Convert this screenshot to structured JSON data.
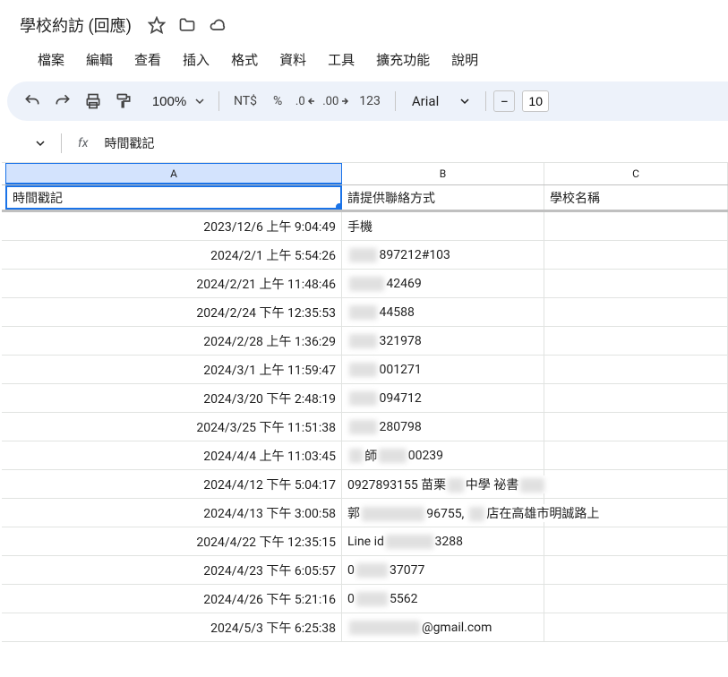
{
  "doc": {
    "title": "學校約訪 (回應)"
  },
  "menu": {
    "file": "檔案",
    "edit": "編輯",
    "view": "查看",
    "insert": "插入",
    "format": "格式",
    "data": "資料",
    "tools": "工具",
    "extensions": "擴充功能",
    "help": "說明"
  },
  "toolbar": {
    "zoom": "100%",
    "currency": "NT$",
    "percent": "%",
    "dec_dec": ".0",
    "inc_dec": ".00",
    "more_fmt": "123",
    "font": "Arial",
    "font_size": "10"
  },
  "formula": {
    "fx": "fx",
    "text": "時間戳記"
  },
  "columns": {
    "A": "A",
    "B": "B",
    "C": "C"
  },
  "headers": {
    "A": "時間戳記",
    "B": "請提供聯絡方式",
    "C": "學校名稱"
  },
  "rows": [
    {
      "A": "2023/12/6 上午 9:04:49",
      "B": "手機",
      "C": ""
    },
    {
      "A": "2024/2/1 上午 5:54:26",
      "B_pre": "",
      "B_mask": "0000",
      "B_post": "897212#103",
      "C": ""
    },
    {
      "A": "2024/2/21 上午 11:48:46",
      "B_pre": "",
      "B_mask": "00000",
      "B_post": "42469",
      "C": ""
    },
    {
      "A": "2024/2/24 下午 12:35:53",
      "B_pre": "",
      "B_mask": "0000",
      "B_post": "44588",
      "C": ""
    },
    {
      "A": "2024/2/28 上午 1:36:29",
      "B_pre": "",
      "B_mask": "0000",
      "B_post": "321978",
      "C": ""
    },
    {
      "A": "2024/3/1 上午 11:59:47",
      "B_pre": "",
      "B_mask": "0000",
      "B_post": "001271",
      "C": ""
    },
    {
      "A": "2024/3/20 下午 2:48:19",
      "B_pre": "",
      "B_mask": "0000",
      "B_post": "094712",
      "C": ""
    },
    {
      "A": "2024/3/25 下午 11:51:38",
      "B_pre": "",
      "B_mask": "0000",
      "B_post": "280798",
      "C": ""
    },
    {
      "A": "2024/4/4 上午 11:03:45",
      "B_pre": "",
      "B_mask": "aa",
      "B_mid": "師",
      "B_mask2": "aaaa",
      "B_post": "00239",
      "C": ""
    },
    {
      "A": "2024/4/12 下午 5:04:17",
      "B_overflow": true,
      "B_pre": "0927893155 苗栗",
      "B_mask": "XX",
      "B_mid": "中學 祕書",
      "B_mask2": "XXX",
      "B_post": "",
      "C": ""
    },
    {
      "A": "2024/4/13 下午 3:00:58",
      "B_overflow": true,
      "B_pre": "郭",
      "B_mask": "XXXXXXXX",
      "B_mid": "96755, ",
      "B_mask2": "XX",
      "B_post": "店在高雄市明誠路上",
      "C": ""
    },
    {
      "A": "2024/4/22 下午 12:35:15",
      "B_pre": "Line id",
      "B_mask": "XXXXXX",
      "B_post": "3288",
      "C": ""
    },
    {
      "A": "2024/4/23 下午 6:05:57",
      "B_pre": "0",
      "B_mask": "XXXX",
      "B_post": "37077",
      "C": ""
    },
    {
      "A": "2024/4/26 下午 5:21:16",
      "B_pre": "0",
      "B_mask": "XXXX",
      "B_post": "5562",
      "C": ""
    },
    {
      "A": "2024/5/3 下午 6:25:38",
      "B_overflow": true,
      "B_pre": "",
      "B_mask": "XXXXXXXXX",
      "B_post": "@gmail.com",
      "C": ""
    }
  ]
}
